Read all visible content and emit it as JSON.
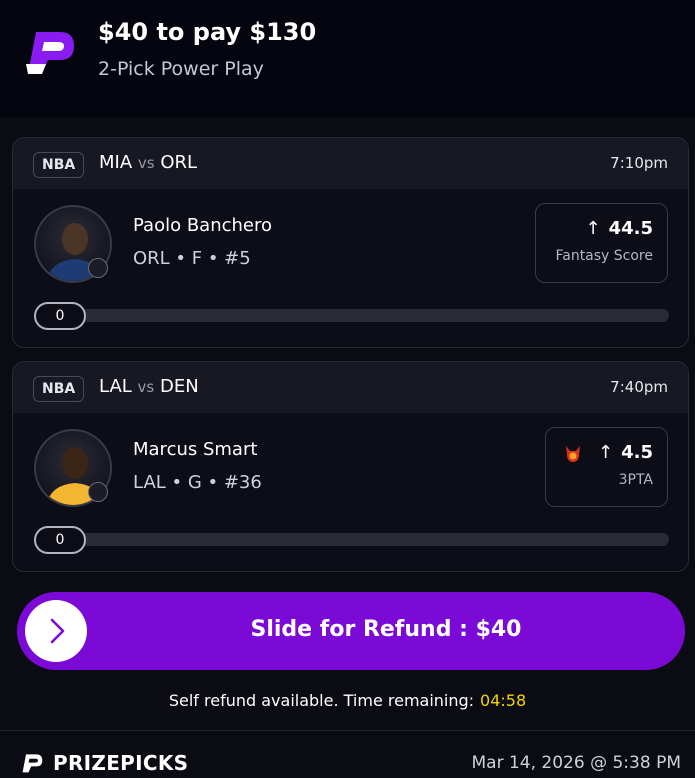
{
  "header": {
    "title": "$40 to pay $130",
    "subtitle": "2-Pick Power Play"
  },
  "picks": [
    {
      "league": "NBA",
      "team_a": "MIA",
      "vs": "vs",
      "team_b": "ORL",
      "time": "7:10pm",
      "player_name": "Paolo Banchero",
      "player_meta": "ORL • F • #5",
      "line": "44.5",
      "stat": "Fantasy Score",
      "progress": "0",
      "jersey_color": "#1f3b73",
      "demon": false
    },
    {
      "league": "NBA",
      "team_a": "LAL",
      "vs": "vs",
      "team_b": "DEN",
      "time": "7:40pm",
      "player_name": "Marcus Smart",
      "player_meta": "LAL • G • #36",
      "line": "4.5",
      "stat": "3PTA",
      "progress": "0",
      "jersey_color": "#f2b632",
      "demon": true
    }
  ],
  "refund": {
    "slide_label": "Slide for Refund : $40",
    "note": "Self refund available. Time remaining:",
    "timer": "04:58"
  },
  "footer": {
    "brand": "PRIZEPICKS",
    "date": "Mar 14, 2026 @ 5:38 PM"
  },
  "colors": {
    "accent": "#7b0ad6",
    "timer": "#f5d400"
  }
}
